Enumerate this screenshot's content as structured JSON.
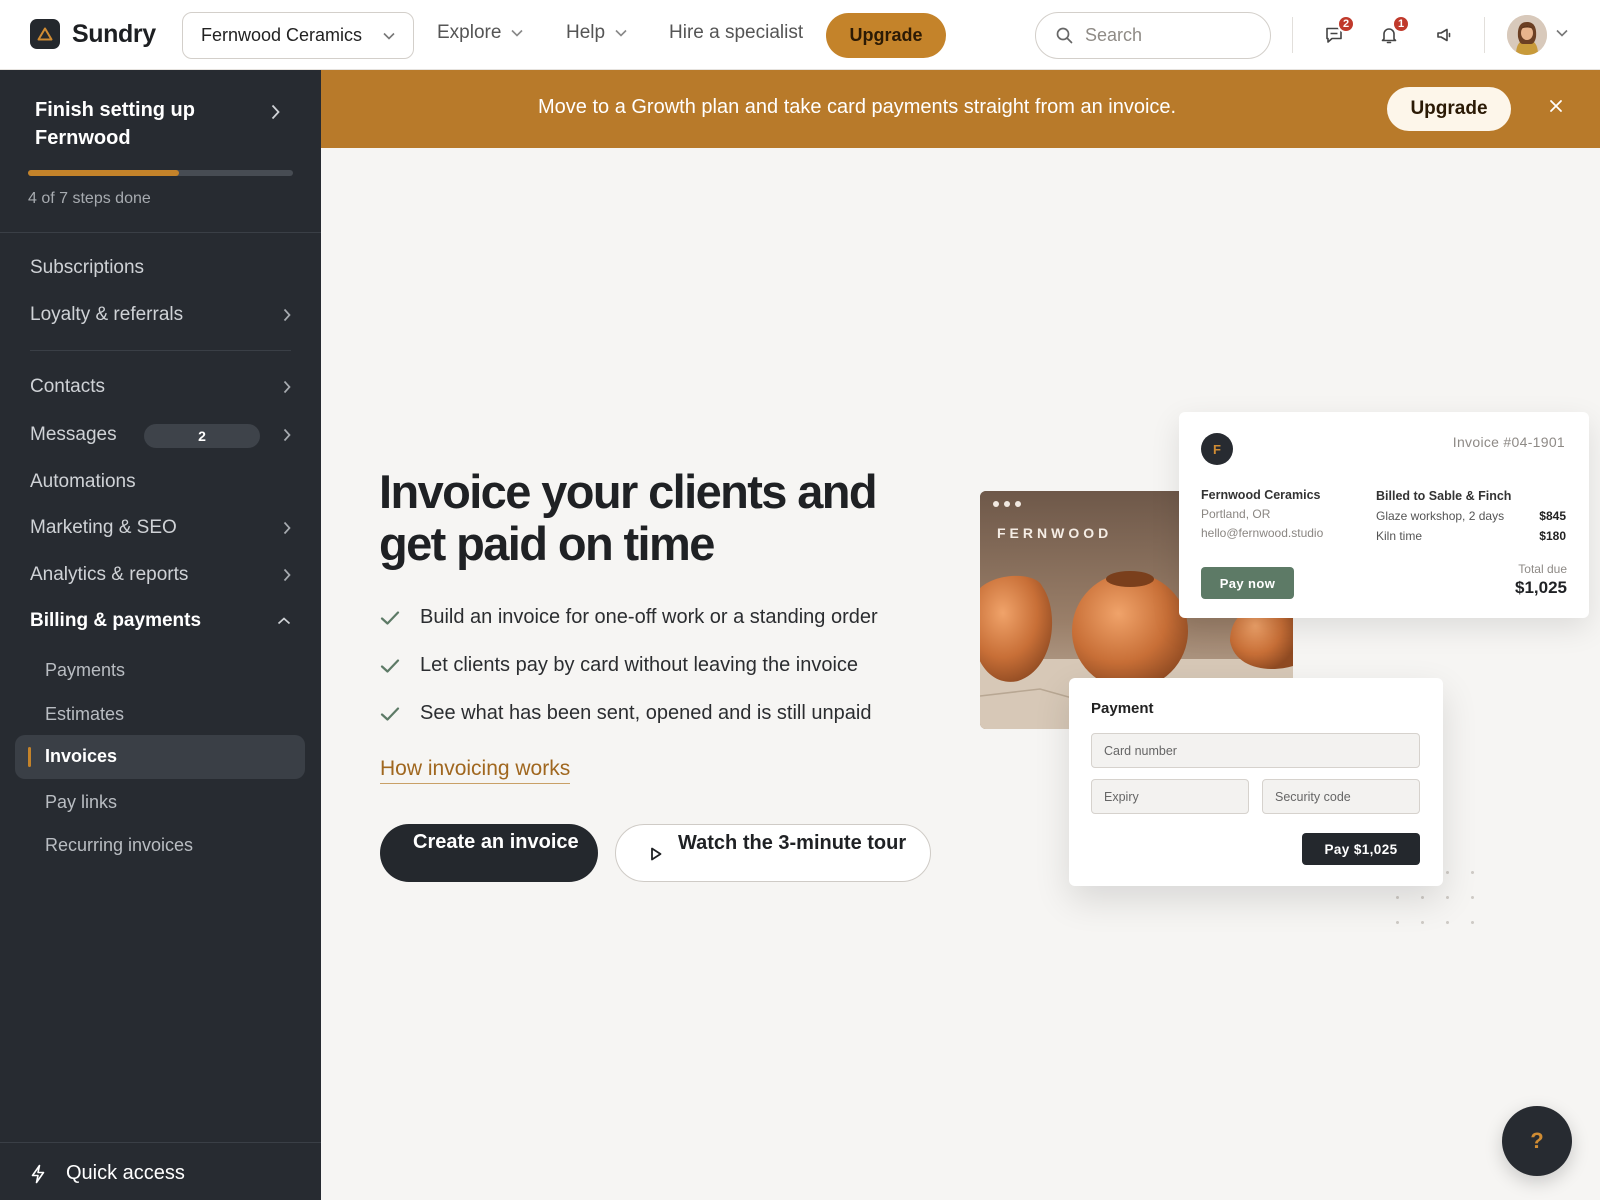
{
  "app": {
    "name": "Sundry"
  },
  "header": {
    "account": "Fernwood Ceramics",
    "nav": [
      "Explore",
      "Help"
    ],
    "hire": "Hire a specialist",
    "upgrade": "Upgrade",
    "search_placeholder": "Search",
    "messages_count": "2",
    "notifications_count": "1"
  },
  "sidebar": {
    "setup_title": "Finish setting up Fernwood",
    "setup_status": "4 of 7 steps done",
    "setup_progress": 0.5714,
    "items": {
      "subscriptions": "Subscriptions",
      "loyalty": "Loyalty & referrals",
      "contacts": "Contacts",
      "messages": "Messages",
      "messages_badge": "2",
      "automations": "Automations",
      "marketing": "Marketing & SEO",
      "analytics": "Analytics & reports",
      "billing": "Billing & payments"
    },
    "billing_sub": {
      "payments": "Payments",
      "estimates": "Estimates",
      "invoices": "Invoices",
      "pay_links": "Pay links",
      "recurring": "Recurring invoices"
    },
    "quick_access": "Quick access"
  },
  "banner": {
    "text": "Move to a Growth plan and take card payments straight from an invoice.",
    "button": "Upgrade"
  },
  "hero": {
    "title": "Invoice your clients and get paid on time",
    "features": [
      "Build an invoice for one-off work or a standing order",
      "Let clients pay by card without leaving the invoice",
      "See what has been sent, opened and is still unpaid"
    ],
    "link": "How invoicing works",
    "primary_button": "Create an invoice",
    "secondary_button": "Watch the 3-minute tour"
  },
  "illustration": {
    "photo_brand": "FERNWOOD",
    "invoice": {
      "logo_letter": "F",
      "number": "Invoice #04-1901",
      "from_name": "Fernwood Ceramics",
      "from_city": "Portland, OR",
      "from_email": "hello@fernwood.studio",
      "billed_to": "Billed to Sable & Finch",
      "lines": [
        {
          "desc": "Glaze workshop, 2 days",
          "amount": "$845"
        },
        {
          "desc": "Kiln time",
          "amount": "$180"
        }
      ],
      "pay_now": "Pay now",
      "total_label": "Total due",
      "total": "$1,025"
    },
    "payment": {
      "title": "Payment",
      "card_number": "Card number",
      "expiry": "Expiry",
      "security": "Security code",
      "pay_button": "Pay $1,025"
    }
  },
  "help_fab": "?",
  "colors": {
    "accent": "#c4832a",
    "sidebar": "#272b31",
    "banner": "#b87a2a"
  }
}
